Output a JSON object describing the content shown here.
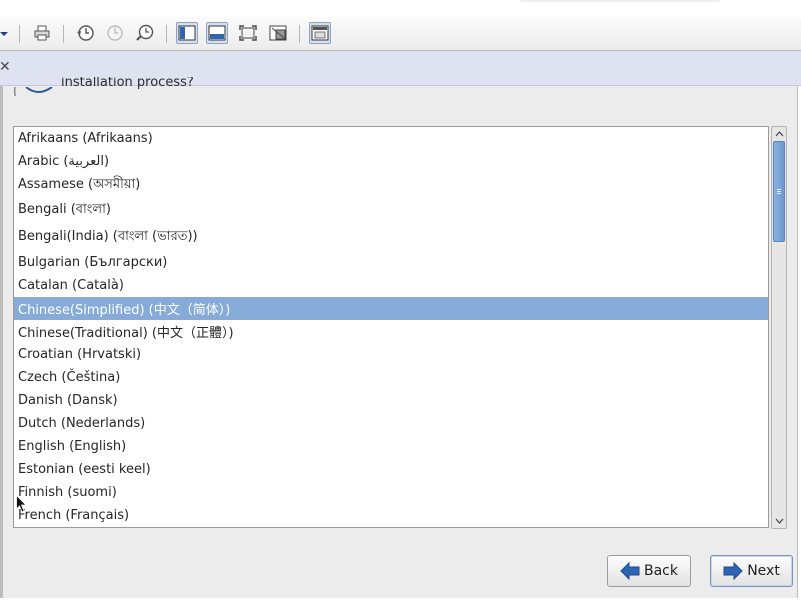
{
  "toolbar": {
    "icons": [
      "dropdown-arrow-icon",
      "print-icon",
      "history-icon",
      "history-disabled-icon",
      "history-search-icon",
      "sidebar-toggle-icon",
      "bottom-panel-icon",
      "fullscreen-icon",
      "detach-icon",
      "window-layout-icon"
    ]
  },
  "header": {
    "partial_text": "installation process?"
  },
  "language_list": {
    "items": [
      "Afrikaans (Afrikaans)",
      "Arabic (العربية)",
      "Assamese (অসমীয়া)",
      "Bengali (বাংলা)",
      "Bengali(India) (বাংলা (ভারত))",
      "Bulgarian (Български)",
      "Catalan (Català)",
      "Chinese(Simplified) (中文（简体）)",
      "Chinese(Traditional) (中文（正體）)",
      "Croatian (Hrvatski)",
      "Czech (Čeština)",
      "Danish (Dansk)",
      "Dutch (Nederlands)",
      "English (English)",
      "Estonian (eesti keel)",
      "Finnish (suomi)",
      "French (Français)"
    ],
    "selected_index": 7
  },
  "buttons": {
    "back_label": "Back",
    "next_label": "Next"
  },
  "colors": {
    "selection": "#86abd9",
    "accent": "#2e64b4"
  }
}
